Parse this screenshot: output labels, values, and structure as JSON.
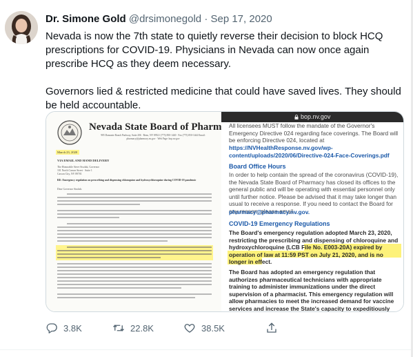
{
  "tweet": {
    "author_name": "Dr. Simone Gold",
    "handle": "@drsimonegold",
    "separator": "·",
    "date": "Sep 17, 2020",
    "paragraphs": [
      "Nevada is now the 7th state to quietly reverse their decision to block HCQ prescriptions for COVID-19. Physicians in Nevada can now once again prescribe HCQ as they deem necessary.",
      "Governors lied & restricted medicine that could have saved lives. They should be held accountable."
    ]
  },
  "letter": {
    "title": "Nevada State Board of Pharmacy",
    "address": "985 Damonte Ranch Parkway, Suite 206 · Reno, NV 89521 (775) 850-1440 · Fax (775) 850-1444 Email: pharmacy@pharmacy.nv.gov · Web Page: bop.nv.gov",
    "date_line": "March 23, 2020",
    "delivery": "VIA EMAIL AND HAND DELIVERY",
    "recipient": [
      "The Honorable Steve Sisolak, Governor",
      "101 North Carson Street · Suite 1",
      "Carson City, NV 89701"
    ],
    "re": "RE:   Emergency regulation on prescribing and dispensing chloroquine and hydroxychloroquine during COVID-19 pandemic",
    "salutation": "Dear Governor Sisolak:"
  },
  "web": {
    "url": "bop.nv.gov",
    "intro": "All licensees MUST follow the mandate of the Governor's Emergency Directive 024 regarding face coverings. The Board will be enforcing Directive 024, located at",
    "link": "https://NVHealthResponse.nv.gov/wp-content/uploads/2020/06/Directive-024-Face-Coverings.pdf",
    "office_heading": "Board Office Hours",
    "office_text": "In order to help contain the spread of the coronavirus (COVID-19), the Nevada State Board of Pharmacy has closed its offices to the general public and will be operating with essential personnel only until further notice. Please be advised that it may take longer than usual to receive a response. If you need to contact the Board for any reason, please email",
    "office_email": "pharmacy@pharmacy.nv.gov.",
    "covid_heading": "COVID-19 Emergency Regulations",
    "covid_text1": "The Board's emergency regulation adopted March 23, 2020, restricting the prescribing and dispensing of chloroquine and hydroxychloroquine (LCB File No. E003-20A) expired by operation of law at 11:59 PST on July 21, 2020, and is no longer in effect.",
    "covid_text2": "The Board has adopted an emergency regulation that authorizes pharmaceutical technicians with appropriate training to administer immunizations under the direct supervision of a pharmacist.  This emergency regulation will allow pharmacies to meet the increased demand for vaccine services and increase the State's capacity to expeditiously treat Nevada's population when a viable COVID-19 vaccine is developed and deployed"
  },
  "actions": {
    "replies": "3.8K",
    "retweets": "22.8K",
    "likes": "38.5K"
  },
  "colors": {
    "link": "#1a58a8",
    "highlight": "#fdf27a",
    "secondary_text": "#536471"
  },
  "icons": [
    "reply-icon",
    "retweet-icon",
    "like-icon",
    "share-icon",
    "lock-icon",
    "state-seal-icon"
  ]
}
